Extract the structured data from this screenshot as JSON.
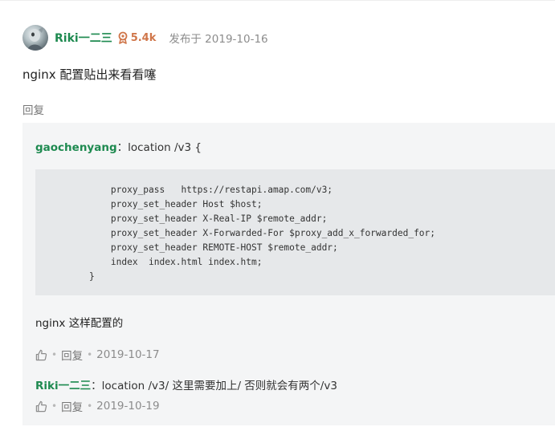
{
  "post": {
    "author": "Riki一二三",
    "reputation": "5.4k",
    "published": "发布于 2019-10-16",
    "body": "nginx 配置贴出来看看噻",
    "reply_label": "回复"
  },
  "quote": {
    "author": "gaochenyang",
    "separator": "：",
    "first_line": "location /v3 {",
    "code": "        proxy_pass   https://restapi.amap.com/v3;\n        proxy_set_header Host $host;\n        proxy_set_header X-Real-IP $remote_addr;\n        proxy_set_header X-Forwarded-For $proxy_add_x_forwarded_for;\n        proxy_set_header REMOTE-HOST $remote_addr;\n        index  index.html index.htm;\n    }",
    "follow_text": "nginx 这样配置的",
    "meta": {
      "dot": "•",
      "reply_label": "回复",
      "date": "2019-10-17"
    }
  },
  "nested_reply": {
    "author": "Riki一二三",
    "separator": "：",
    "text": "location /v3/ 这里需要加上/ 否则就会有两个/v3",
    "meta": {
      "dot": "•",
      "reply_label": "回复",
      "date": "2019-10-19"
    }
  },
  "colors": {
    "username": "#1e8a50",
    "reputation": "#d0764a",
    "muted": "#8c8c8c",
    "quote_bg": "#f4f5f6",
    "code_bg": "#e6e8ea"
  },
  "icons": {
    "reputation": "medal-icon",
    "like": "thumb-up-icon"
  }
}
